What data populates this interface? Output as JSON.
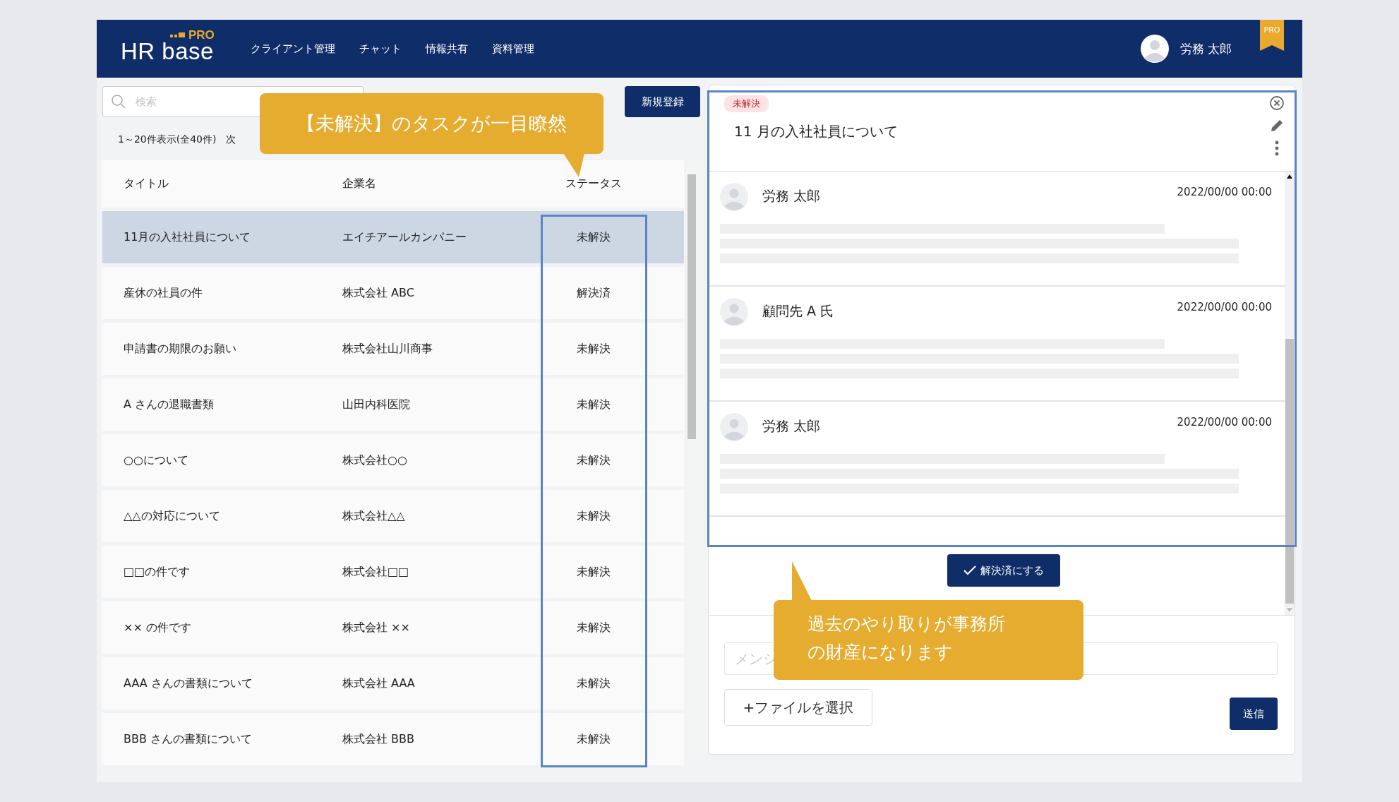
{
  "header": {
    "logo": "HR base",
    "logo_badge": "PRO",
    "nav": [
      {
        "label": "クライアント管理"
      },
      {
        "label": "チャット"
      },
      {
        "label": "情報共有"
      },
      {
        "label": "資料管理"
      }
    ],
    "user_name": "労務 太郎",
    "plan_ribbon": "PRO"
  },
  "list": {
    "search": {
      "placeholder": "検索"
    },
    "new_button": "新規登録",
    "pagination": "1～20件表示(全40件)",
    "next_link": "次",
    "columns": [
      "タイトル",
      "企業名",
      "ステータス"
    ],
    "rows": [
      {
        "title": "11月の入社社員について",
        "company": "エイチアールカンパニー",
        "status": "未解決",
        "selected": true
      },
      {
        "title": "産休の社員の件",
        "company": "株式会社 ABC",
        "status": "解決済",
        "selected": false
      },
      {
        "title": "申請書の期限のお願い",
        "company": "株式会社山川商事",
        "status": "未解決",
        "selected": false
      },
      {
        "title": "A さんの退職書類",
        "company": "山田内科医院",
        "status": "未解決",
        "selected": false
      },
      {
        "title": "○○について",
        "company": "株式会社○○",
        "status": "未解決",
        "selected": false
      },
      {
        "title": "△△の対応について",
        "company": "株式会社△△",
        "status": "未解決",
        "selected": false
      },
      {
        "title": "□□の件です",
        "company": "株式会社□□",
        "status": "未解決",
        "selected": false
      },
      {
        "title": "×× の件です",
        "company": "株式会社 ××",
        "status": "未解決",
        "selected": false
      },
      {
        "title": "AAA さんの書類について",
        "company": "株式会社 AAA",
        "status": "未解決",
        "selected": false
      },
      {
        "title": "BBB さんの書類について",
        "company": "株式会社 BBB",
        "status": "未解決",
        "selected": false
      }
    ]
  },
  "detail": {
    "status_badge": "未解決",
    "title": "11 月の入社社員について",
    "messages": [
      {
        "author": "労務 太郎",
        "time": "2022/00/00  00:00"
      },
      {
        "author": "顧問先 A 氏",
        "time": "2022/00/00  00:00"
      },
      {
        "author": "労務 太郎",
        "time": "2022/00/00  00:00"
      }
    ],
    "resolve_button": "解決済にする",
    "message_input": {
      "placeholder": "メンシ"
    },
    "file_button": "+ファイルを選択",
    "send_button": "送信"
  },
  "callouts": [
    {
      "text": "【未解決】のタスクが一目瞭然"
    },
    {
      "text": "過去のやり取りが事務所の財産になります"
    }
  ]
}
